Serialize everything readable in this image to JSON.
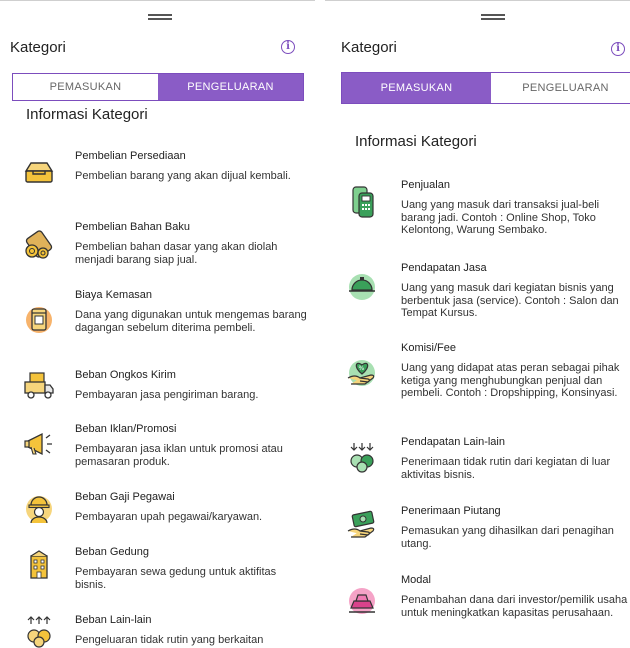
{
  "left_screen": {
    "app_title": "Kategori",
    "tabs": [
      {
        "label": "PEMASUKAN",
        "active": false
      },
      {
        "label": "PENGELUARAN",
        "active": true
      }
    ],
    "section_title": "Informasi Kategori",
    "items": [
      {
        "name": "Pembelian Persediaan",
        "desc": "Pembelian barang yang akan dijual kembali.",
        "icon": "inventory-tray-icon"
      },
      {
        "name": "Pembelian Bahan Baku",
        "desc": "Pembelian bahan dasar yang akan diolah menjadi barang siap jual.",
        "icon": "wood-logs-icon"
      },
      {
        "name": "Biaya Kemasan",
        "desc": "Dana yang digunakan untuk mengemas barang dagangan sebelum diterima pembeli.",
        "icon": "package-box-icon"
      },
      {
        "name": "Beban Ongkos Kirim",
        "desc": "Pembayaran jasa pengiriman barang.",
        "icon": "delivery-truck-icon"
      },
      {
        "name": "Beban Iklan/Promosi",
        "desc": "Pembayaran jasa iklan untuk promosi atau pemasaran produk.",
        "icon": "megaphone-icon"
      },
      {
        "name": "Beban Gaji Pegawai",
        "desc": "Pembayaran upah pegawai/karyawan.",
        "icon": "worker-helmet-icon"
      },
      {
        "name": "Beban Gedung",
        "desc": "Pembayaran sewa gedung untuk aktifitas bisnis.",
        "icon": "building-icon"
      },
      {
        "name": "Beban Lain-lain",
        "desc": "Pengeluaran tidak rutin yang berkaitan",
        "icon": "coins-arrows-up-icon"
      }
    ]
  },
  "right_screen": {
    "app_title": "Kategori",
    "tabs": [
      {
        "label": "PEMASUKAN",
        "active": true
      },
      {
        "label": "PENGELUARAN",
        "active": false
      }
    ],
    "section_title": "Informasi Kategori",
    "items": [
      {
        "name": "Penjualan",
        "desc": "Uang yang masuk dari transaksi jual-beli barang jadi. Contoh : Online Shop, Toko Kelontong, Warung Sembako.",
        "icon": "cash-register-icon"
      },
      {
        "name": "Pendapatan Jasa",
        "desc": "Uang yang masuk dari kegiatan bisnis yang berbentuk jasa (service). Contoh : Salon dan Tempat Kursus.",
        "icon": "service-cloche-icon"
      },
      {
        "name": "Komisi/Fee",
        "desc": "Uang yang didapat atas peran sebagai pihak ketiga yang menghubungkan penjual dan pembeli. Contoh : Dropshipping, Konsinyasi.",
        "icon": "hand-heart-percent-icon"
      },
      {
        "name": "Pendapatan Lain-lain",
        "desc": "Penerimaan tidak rutin dari kegiatan di luar aktivitas bisnis.",
        "icon": "coins-arrows-down-icon"
      },
      {
        "name": "Penerimaan Piutang",
        "desc": "Pemasukan yang dihasilkan dari penagihan utang.",
        "icon": "hand-cash-icon"
      },
      {
        "name": "Modal",
        "desc": "Penambahan dana dari investor/pemilik usaha untuk meningkatkan kapasitas perusahaan.",
        "icon": "gold-bars-icon"
      }
    ]
  },
  "colors": {
    "accent": "#8a5cc6",
    "icon_yellow": "#f4c33b",
    "icon_green": "#3aa05a"
  }
}
